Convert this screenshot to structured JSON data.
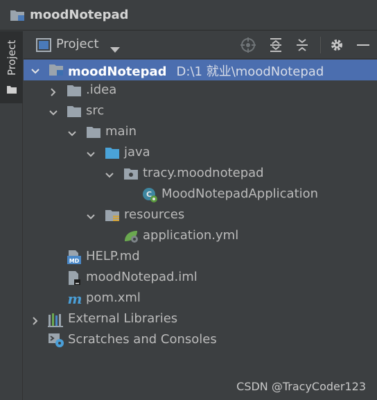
{
  "window": {
    "title": "moodNotepad"
  },
  "side_strip": {
    "tab_label": "Project"
  },
  "panel": {
    "title": "Project",
    "icons": [
      "locate-icon",
      "expand-all-icon",
      "collapse-all-icon",
      "gear-icon",
      "minimize-icon"
    ]
  },
  "tree": {
    "root": {
      "label": "moodNotepad",
      "path": "D:\\1 就业\\moodNotepad"
    },
    "idea": ".idea",
    "src": "src",
    "main": "main",
    "java": "java",
    "package": "tracy.moodnotepad",
    "app_class": "MoodNotepadApplication",
    "resources": "resources",
    "app_yml": "application.yml",
    "help_md": "HELP.md",
    "iml": "moodNotepad.iml",
    "pom": "pom.xml",
    "ext_libs": "External Libraries",
    "scratches": "Scratches and Consoles"
  },
  "watermark": "CSDN @TracyCoder123",
  "colors": {
    "background": "#3c3f41",
    "selection": "#4b6eaf",
    "folder": "#9aa4ad",
    "source_folder": "#4aa3d8"
  }
}
